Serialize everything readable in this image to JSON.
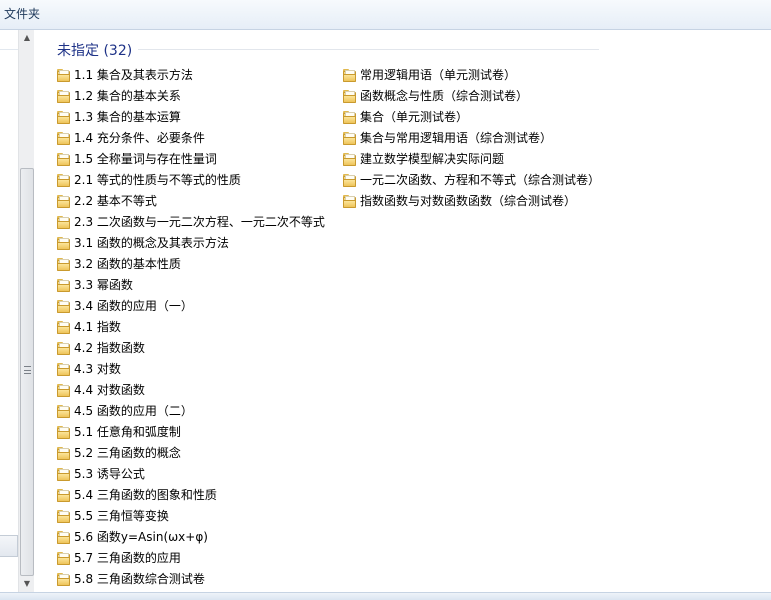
{
  "toolbar": {
    "new_folder_label": "文件夹"
  },
  "group": {
    "title": "未指定 (32)"
  },
  "folders_left": [
    "1.1 集合及其表示方法",
    "1.2 集合的基本关系",
    "1.3 集合的基本运算",
    "1.4 充分条件、必要条件",
    "1.5 全称量词与存在性量词",
    "2.1 等式的性质与不等式的性质",
    "2.2 基本不等式",
    "2.3 二次函数与一元二次方程、一元二次不等式",
    "3.1 函数的概念及其表示方法",
    "3.2 函数的基本性质",
    "3.3 幂函数",
    "3.4 函数的应用（一）",
    "4.1 指数",
    "4.2 指数函数",
    "4.3 对数",
    "4.4 对数函数",
    "4.5 函数的应用（二）",
    "5.1 任意角和弧度制",
    "5.2 三角函数的概念",
    "5.3 诱导公式",
    "5.4 三角函数的图象和性质",
    "5.5 三角恒等变换",
    "5.6 函数y=Asin(ωx+φ)",
    "5.7 三角函数的应用",
    "5.8 三角函数综合测试卷"
  ],
  "folders_right": [
    "常用逻辑用语（单元测试卷）",
    "函数概念与性质（综合测试卷）",
    "集合（单元测试卷）",
    "集合与常用逻辑用语（综合测试卷）",
    "建立数学模型解决实际问题",
    "一元二次函数、方程和不等式（综合测试卷）",
    "指数函数与对数函数函数（综合测试卷）"
  ],
  "icons": {
    "folder": "folder-icon",
    "scroll_up": "scroll-up-arrow-icon",
    "scroll_down": "scroll-down-arrow-icon"
  }
}
